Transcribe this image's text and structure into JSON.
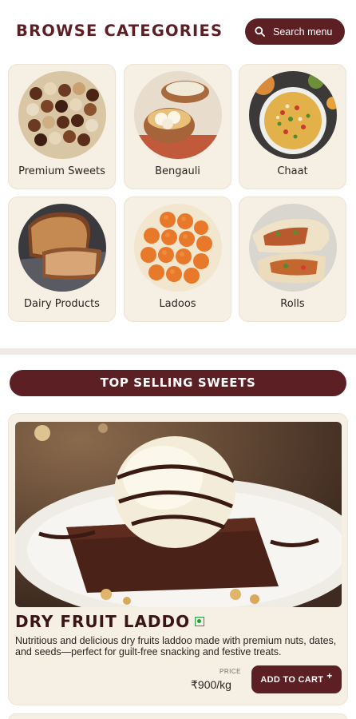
{
  "header": {
    "title": "BROWSE CATEGORIES",
    "search_label": "Search menu"
  },
  "categories": [
    {
      "label": "Premium Sweets"
    },
    {
      "label": "Bengauli"
    },
    {
      "label": "Chaat"
    },
    {
      "label": "Dairy Products"
    },
    {
      "label": "Ladoos"
    },
    {
      "label": "Rolls"
    }
  ],
  "section": {
    "title": "TOP SELLING SWEETS"
  },
  "product": {
    "name": "DRY FRUIT LADDO",
    "description": "Nutritious and delicious dry fruits laddoo made with premium nuts, dates, and seeds—perfect for guilt-free snacking and festive treats.",
    "price_label": "PRICE",
    "price": "₹900/kg",
    "cart_label": "ADD TO CART",
    "cart_plus": "+"
  },
  "colors": {
    "brand": "#5c1f24",
    "card_bg": "#f6efe3",
    "veg_green": "#1f9e3a"
  }
}
